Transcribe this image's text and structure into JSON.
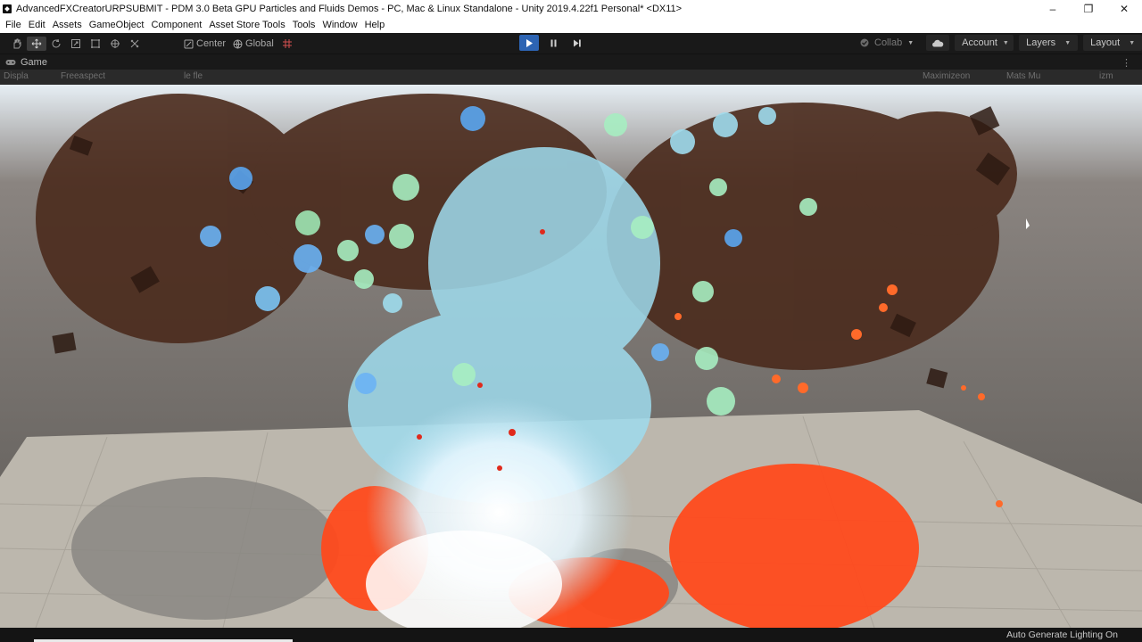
{
  "window": {
    "title": "AdvancedFXCreatorURPSUBMIT - PDM 3.0 Beta GPU Particles and Fluids Demos - PC, Mac & Linux Standalone - Unity 2019.4.22f1 Personal* <DX11>"
  },
  "menu": {
    "items": [
      "File",
      "Edit",
      "Assets",
      "GameObject",
      "Component",
      "Asset Store Tools",
      "Tools",
      "Window",
      "Help"
    ]
  },
  "toolbar": {
    "pivot_label": "Center",
    "space_label": "Global",
    "collab_label": "Collab",
    "account_label": "Account",
    "layers_label": "Layers",
    "layout_label": "Layout",
    "play_state": "playing"
  },
  "game_tab": {
    "label": "Game"
  },
  "game_bar": {
    "display_label": "Displa",
    "aspect_label": "Freeaspect",
    "scale_label": "le fle",
    "maximize_label": "Maximizeon",
    "stats_label": "Mats Mu",
    "gizmos_label": "izm"
  },
  "status": {
    "text": "Auto Generate Lighting On"
  },
  "colors": {
    "accent": "#2d64b3",
    "toolbar_bg": "#191919",
    "menu_bg": "#ffffff"
  }
}
